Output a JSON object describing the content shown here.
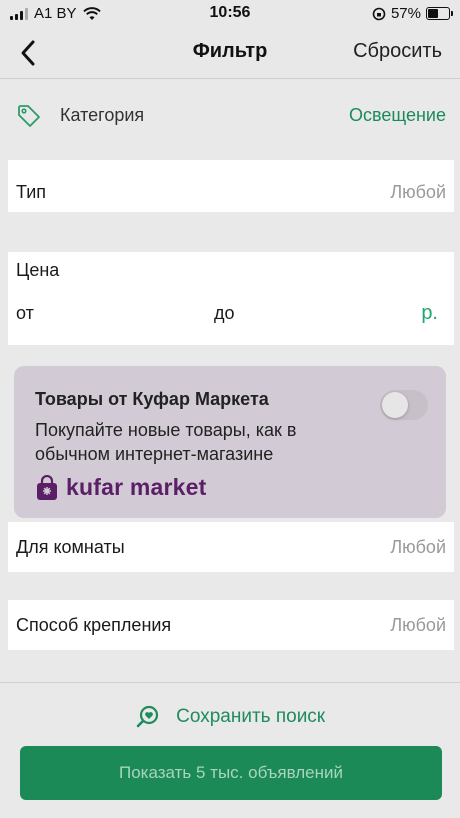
{
  "status_bar": {
    "carrier": "A1 BY",
    "time": "10:56",
    "battery": "57%",
    "battery_level": 0.57
  },
  "nav": {
    "back_icon": "chevron-left-icon",
    "title": "Фильтр",
    "reset_label": "Сбросить"
  },
  "category": {
    "icon": "tag-icon",
    "label": "Категория",
    "value": "Освещение"
  },
  "type_filter": {
    "label": "Тип",
    "value": "Любой"
  },
  "price": {
    "label": "Цена",
    "from_label": "от",
    "to_label": "до",
    "currency": "р."
  },
  "promo": {
    "title": "Товары от Куфар Маркета",
    "text": "Покупайте новые товары, как в обычном интернет-магазине",
    "toggle_on": false,
    "brand": "kufar market"
  },
  "room_filter": {
    "label": "Для комнаты",
    "value": "Любой"
  },
  "mount_filter": {
    "label": "Способ крепления",
    "value": "Любой"
  },
  "save_search": {
    "icon": "heart-search-icon",
    "label": "Сохранить поиск"
  },
  "show_button": {
    "label": "Показать 5 тыс. объявлений"
  },
  "colors": {
    "accent_green": "#1c8a56",
    "link_green": "#1e8c5d",
    "brand_purple": "#5a1f66"
  }
}
